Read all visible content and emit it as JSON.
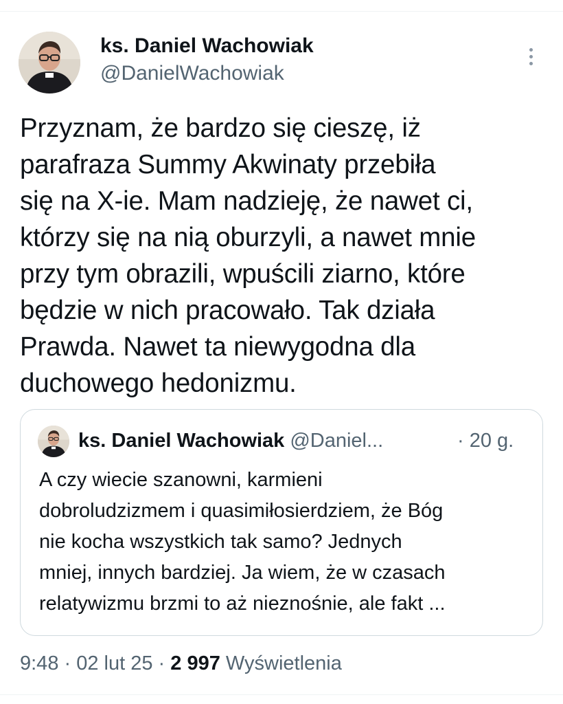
{
  "author": {
    "name": "ks. Daniel Wachowiak",
    "handle": "@DanielWachowiak"
  },
  "tweet": {
    "text": "Przyznam, że bardzo się cieszę, iż\nparafraza Summy Akwinaty przebiła\nsię na X-ie. Mam nadzieję, że nawet ci,\nktórzy się na nią oburzyli, a nawet mnie\nprzy tym obrazili, wpuścili ziarno, które\nbędzie w nich pracowało. Tak działa\nPrawda. Nawet ta niewygodna dla\nduchowego hedonizmu."
  },
  "quote": {
    "name": "ks. Daniel Wachowiak",
    "handle": "@Daniel...",
    "time": "· 20 g.",
    "text": "A czy wiecie szanowni, karmieni\ndobroludzizmem i quasimiłosierdziem, że Bóg\nnie kocha wszystkich tak samo? Jednych\nmniej, innych bardziej. Ja wiem, że w czasach\nrelatywizmu brzmi to aż nieznośnie, ale fakt ..."
  },
  "meta": {
    "time": "9:48",
    "sep1": " · ",
    "date": "02 lut 25",
    "sep2": " · ",
    "views_count": "2 997",
    "views_label": " Wyświetlenia"
  },
  "icons": {
    "more": "more-vertical-icon"
  },
  "colors": {
    "text_primary": "#0f1419",
    "text_secondary": "#536471",
    "border": "#cfd9de"
  }
}
